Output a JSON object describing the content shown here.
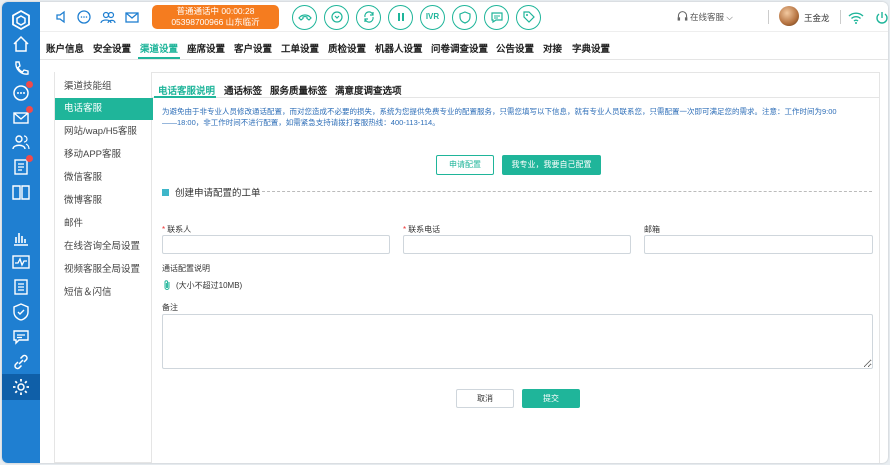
{
  "colors": {
    "rail": "#1f7fd1",
    "accent": "#1fb59a",
    "call": "#f57c1f",
    "notice": "#2f6fb8",
    "badge": "#f04b4b"
  },
  "rail": {
    "icons": [
      "logo-hexagon-icon",
      "home-icon",
      "phone-icon",
      "chat-icon",
      "mail-icon",
      "contacts-icon",
      "list-icon",
      "book-icon",
      "bar-chart-icon",
      "pulse-chart-icon",
      "ticket-icon",
      "shield-icon",
      "message-icon",
      "link-icon",
      "gear-icon"
    ]
  },
  "topbar": {
    "call_status": "普通通话中  00:00:28",
    "call_number": "05398700966 山东临沂",
    "ivr_label": "IVR",
    "agent_status": "在线客服",
    "user_name": "王金龙"
  },
  "nav": {
    "tabs": [
      "账户信息",
      "安全设置",
      "渠道设置",
      "座席设置",
      "客户设置",
      "工单设置",
      "质检设置",
      "机器人设置",
      "问卷调查设置",
      "公告设置",
      "对接",
      "字典设置"
    ],
    "active": "渠道设置"
  },
  "side": {
    "items": [
      "渠道技能组",
      "电话客服",
      "网站/wap/H5客服",
      "移动APP客服",
      "微信客服",
      "微博客服",
      "邮件",
      "在线咨询全局设置",
      "视频客服全局设置",
      "短信＆闪信"
    ],
    "active": "电话客服"
  },
  "subtabs": [
    "电话客服说明",
    "通话标签",
    "服务质量标签",
    "满意度调查选项"
  ],
  "notice": {
    "line1": "为避免由于非专业人员修改通话配置，而对您造成不必要的损失，系统为您提供免费专业的配置服务，只需您填写以下信息，就有专业人员联系您，只需配置一次即可满足您的需求。注意：工作时间为9:00",
    "line2": "——18:00，非工作时间不进行配置，如需紧急支持请拨打客服热线：400-113-114。"
  },
  "buttons": {
    "apply": "申请配置",
    "self_config": "我专业，我要自己配置",
    "cancel": "取消",
    "submit": "提交"
  },
  "form": {
    "section_title": "创建申请配置的工单",
    "contact_label": "联系人",
    "phone_label": "联系电话",
    "email_label": "邮箱",
    "required_mark": "*",
    "attachment_label": "通话配置说明",
    "attachment_hint": "(大小不超过10MB)",
    "remark_label": "备注",
    "contact_value": "",
    "phone_value": "",
    "email_value": "",
    "remark_value": ""
  }
}
